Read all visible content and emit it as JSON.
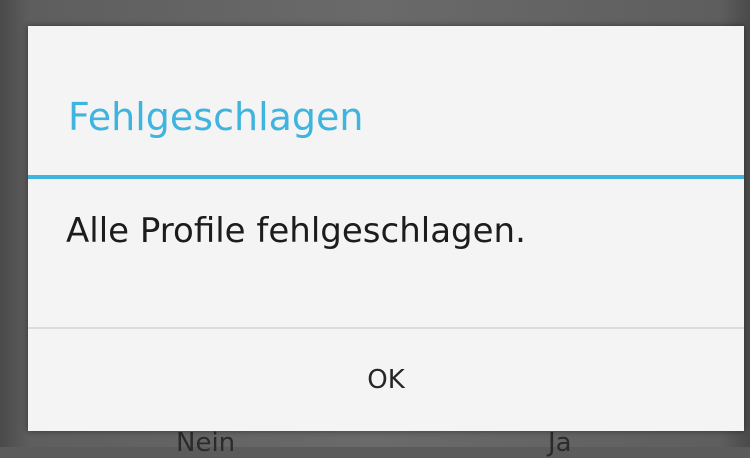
{
  "dialog": {
    "title": "Fehlgeschlagen",
    "message": "Alle Profile fehlgeschlagen.",
    "ok_label": "OK"
  },
  "background_dialog": {
    "no_label": "Nein",
    "yes_label": "Ja"
  },
  "colors": {
    "accent": "#3fb4de",
    "dialog_background": "#f4f4f4",
    "message_text": "#1c1c1c"
  }
}
